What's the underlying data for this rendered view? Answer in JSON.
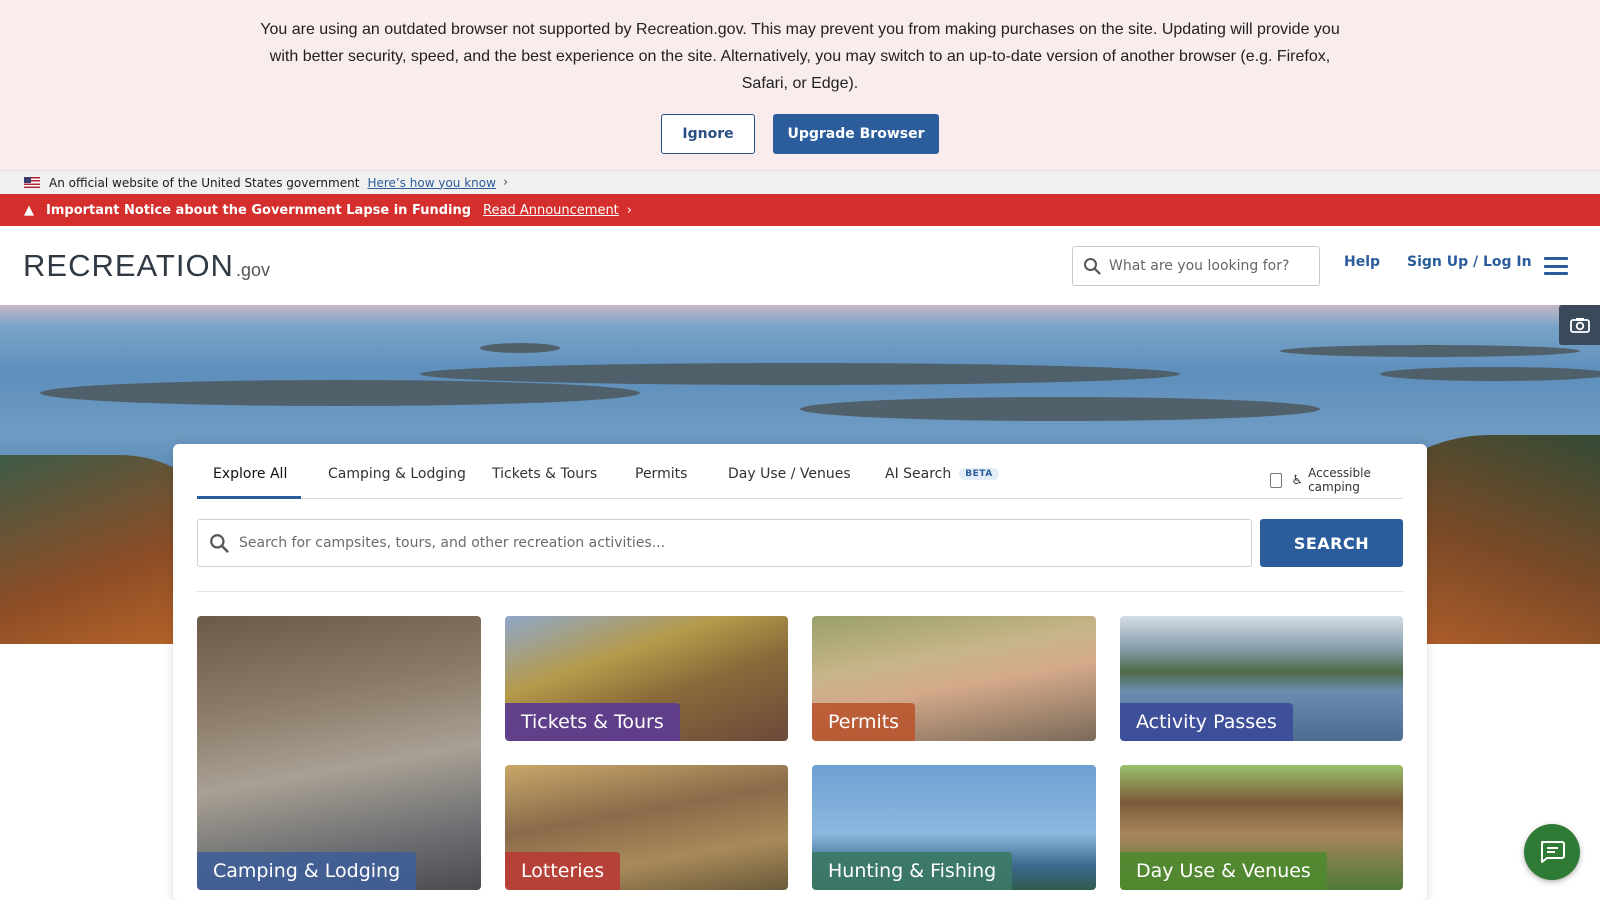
{
  "outdated_banner": {
    "message": "You are using an outdated browser not supported by Recreation.gov. This may prevent you from making purchases on the site. Updating will provide you with better security, speed, and the best experience on the site. Alternatively, you may switch to an up-to-date version of another browser (e.g. Firefox, Safari, or Edge).",
    "ignore_label": "Ignore",
    "upgrade_label": "Upgrade Browser"
  },
  "gov_banner": {
    "text": "An official website of the United States government",
    "link": "Here’s how you know"
  },
  "alert": {
    "text": "Important Notice about the Government Lapse in Funding",
    "link": "Read Announcement"
  },
  "header": {
    "logo_word": "RECREATION",
    "logo_suffix": ".gov",
    "search_placeholder": "What are you looking for?",
    "help": "Help",
    "signin": "Sign Up / Log In"
  },
  "search_card": {
    "tabs": [
      {
        "label": "Explore All"
      },
      {
        "label": "Camping & Lodging"
      },
      {
        "label": "Tickets & Tours"
      },
      {
        "label": "Permits"
      },
      {
        "label": "Day Use / Venues"
      },
      {
        "label": "AI Search",
        "badge": "BETA"
      }
    ],
    "accessible_label": "Accessible camping",
    "search_placeholder": "Search for campsites, tours, and other recreation activities...",
    "search_button": "SEARCH"
  },
  "tiles": [
    {
      "label": "Camping & Lodging",
      "color": "#3f5d97"
    },
    {
      "label": "Tickets & Tours",
      "color": "#5b3a94"
    },
    {
      "label": "Permits",
      "color": "#b9552f"
    },
    {
      "label": "Activity Passes",
      "color": "#3c4b9a"
    },
    {
      "label": "Lotteries",
      "color": "#b83a35"
    },
    {
      "label": "Hunting & Fishing",
      "color": "#3c7a66"
    },
    {
      "label": "Day Use & Venues",
      "color": "#4f8a2f"
    }
  ]
}
